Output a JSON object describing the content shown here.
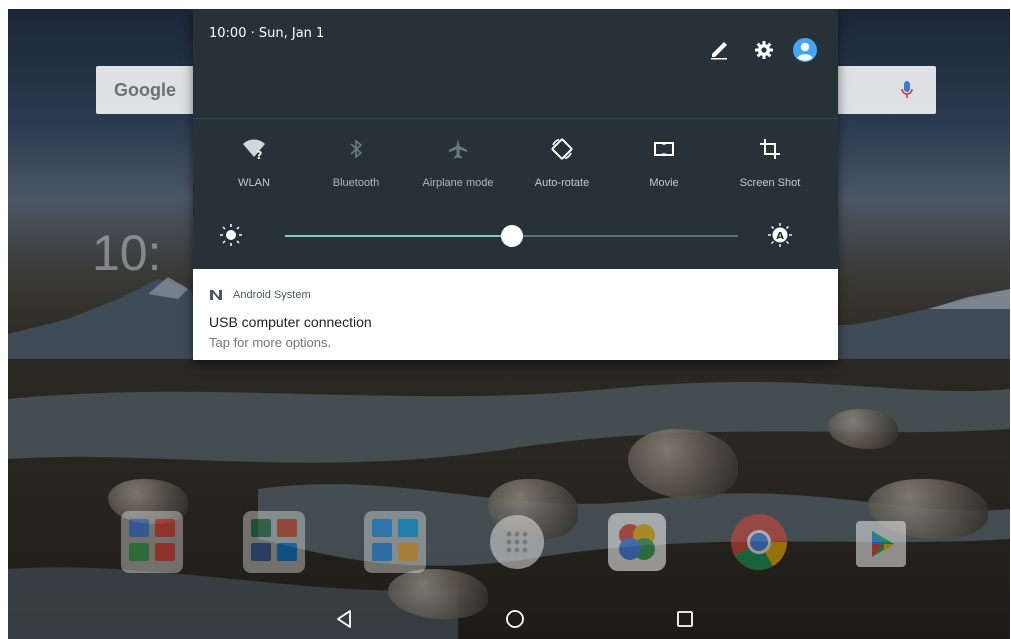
{
  "status": {
    "datetime": "10:00 · Sun, Jan 1"
  },
  "home": {
    "search_logo": "Google",
    "clock_partial": "10:"
  },
  "quick_settings": {
    "tiles": [
      {
        "label": "WLAN",
        "icon": "wifi-unknown-icon",
        "active": true
      },
      {
        "label": "Bluetooth",
        "icon": "bluetooth-icon",
        "active": false
      },
      {
        "label": "Airplane mode",
        "icon": "airplane-icon",
        "active": false
      },
      {
        "label": "Auto-rotate",
        "icon": "auto-rotate-icon",
        "active": true
      },
      {
        "label": "Movie",
        "icon": "dolby-movie-icon",
        "active": true
      },
      {
        "label": "Screen Shot",
        "icon": "crop-icon",
        "active": true
      }
    ],
    "brightness": 0.5
  },
  "notification": {
    "app_name": "Android System",
    "title": "USB computer connection",
    "text": "Tap for more options."
  },
  "dock": {
    "apps": [
      "google-apps-folder",
      "office-folder",
      "lenovo-folder",
      "app-drawer",
      "photos-app",
      "chrome-app",
      "play-store-app"
    ]
  },
  "colors": {
    "shade_bg": "#263238",
    "accent": "#80cbc4",
    "notification_bg": "#ffffff"
  }
}
